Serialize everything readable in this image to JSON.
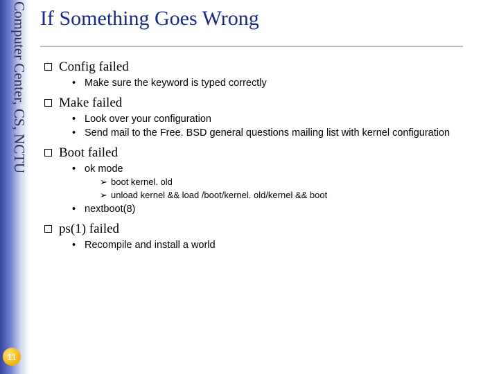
{
  "sidebar": {
    "text": "Computer Center, CS, NCTU"
  },
  "page_number": "11",
  "title": "If Something Goes Wrong",
  "sections": {
    "s1": {
      "heading": "Config failed",
      "b1": "Make sure the keyword is typed correctly"
    },
    "s2": {
      "heading": "Make failed",
      "b1": "Look over your configuration",
      "b2": "Send mail to the Free. BSD general questions mailing list with kernel configuration"
    },
    "s3": {
      "heading": "Boot failed",
      "b1": "ok mode",
      "b1_s1": "boot kernel. old",
      "b1_s2": "unload kernel && load /boot/kernel. old/kernel && boot",
      "b2": "nextboot(8)"
    },
    "s4": {
      "heading": "ps(1) failed",
      "b1": "Recompile and install a world"
    }
  }
}
